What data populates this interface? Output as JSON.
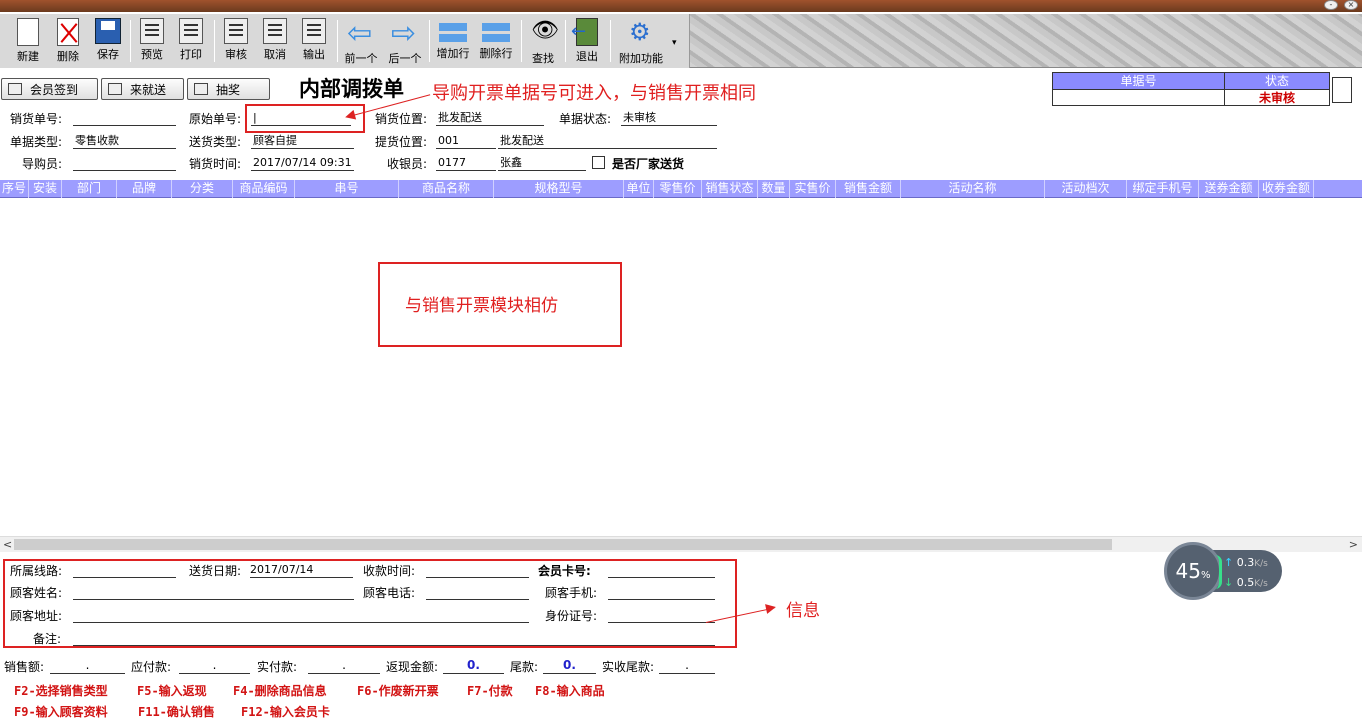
{
  "toolbar": {
    "buttons": [
      {
        "label": "新建",
        "icon": "new-document-icon"
      },
      {
        "label": "删除",
        "icon": "delete-icon"
      },
      {
        "label": "保存",
        "icon": "save-icon"
      },
      {
        "label": "预览",
        "icon": "preview-icon"
      },
      {
        "label": "打印",
        "icon": "print-icon"
      },
      {
        "label": "审核",
        "icon": "audit-icon"
      },
      {
        "label": "取消",
        "icon": "cancel-icon"
      },
      {
        "label": "输出",
        "icon": "export-icon"
      },
      {
        "label": "前一个",
        "icon": "previous-arrow-icon"
      },
      {
        "label": "后一个",
        "icon": "next-arrow-icon"
      },
      {
        "label": "增加行",
        "icon": "add-row-icon"
      },
      {
        "label": "删除行",
        "icon": "delete-row-icon"
      },
      {
        "label": "查找",
        "icon": "binoculars-icon"
      },
      {
        "label": "退出",
        "icon": "exit-door-icon"
      },
      {
        "label": "附加功能",
        "icon": "addon-gear-icon"
      }
    ]
  },
  "action_buttons": {
    "member_checkin": "会员签到",
    "nearby_delivery": "来就送",
    "lottery": "抽奖"
  },
  "form_title": "内部调拨单",
  "status_box": {
    "doc_no_header": "单据号",
    "status_header": "状态",
    "doc_no_value": "",
    "status_value": "未审核",
    "status_color": "#cc0000"
  },
  "header_fields": {
    "sales_doc_no": {
      "label": "销货单号:",
      "value": ""
    },
    "original_doc_no": {
      "label": "原始单号:",
      "value": "|"
    },
    "sales_location": {
      "label": "销货位置:",
      "value": "批发配送"
    },
    "doc_status": {
      "label": "单据状态:",
      "value": "未审核"
    },
    "doc_type": {
      "label": "单据类型:",
      "value": "零售收款"
    },
    "delivery_type": {
      "label": "送货类型:",
      "value": "顾客自提"
    },
    "pickup_location": {
      "label": "提货位置:",
      "code": "001",
      "value": "批发配送"
    },
    "salesperson": {
      "label": "导购员:",
      "value": ""
    },
    "sales_time": {
      "label": "销货时间:",
      "value": "2017/07/14 09:31"
    },
    "cashier": {
      "label": "收银员:",
      "code": "0177",
      "value": "张鑫"
    },
    "manufacturer_delivery": {
      "label": "是否厂家送货",
      "checked": false
    }
  },
  "grid": {
    "columns": [
      "序号",
      "安装",
      "部门",
      "品牌",
      "分类",
      "商品编码",
      "串号",
      "商品名称",
      "规格型号",
      "单位",
      "零售价",
      "销售状态",
      "数量",
      "实售价",
      "销售金额",
      "活动名称",
      "活动档次",
      "绑定手机号",
      "送券金额",
      "收券金额"
    ],
    "header_color": "#9d9dff"
  },
  "customer_info": {
    "route": {
      "label": "所属线路:",
      "value": ""
    },
    "delivery_date": {
      "label": "送货日期:",
      "value": "2017/07/14"
    },
    "payment_time": {
      "label": "收款时间:",
      "value": ""
    },
    "member_card": {
      "label": "会员卡号:",
      "value": ""
    },
    "customer_name": {
      "label": "顾客姓名:",
      "value": ""
    },
    "customer_phone": {
      "label": "顾客电话:",
      "value": ""
    },
    "customer_mobile": {
      "label": "顾客手机:",
      "value": ""
    },
    "customer_address": {
      "label": "顾客地址:",
      "value": ""
    },
    "id_number": {
      "label": "身份证号:",
      "value": ""
    },
    "remark": {
      "label": "备注:",
      "value": ""
    }
  },
  "totals": {
    "sales_amount": {
      "label": "销售额:",
      "value": "."
    },
    "payable": {
      "label": "应付款:",
      "value": "."
    },
    "paid": {
      "label": "实付款:",
      "value": "."
    },
    "cashback": {
      "label": "返现金额:",
      "value": "0."
    },
    "tail": {
      "label": "尾款:",
      "value": "0."
    },
    "actual_tail": {
      "label": "实收尾款:",
      "value": "."
    },
    "highlight_color": "#2222cc"
  },
  "function_keys": {
    "row1": [
      "F2-选择销售类型",
      "F5-输入返现",
      "F4-删除商品信息",
      "F6-作废新开票",
      "F7-付款",
      "F8-输入商品"
    ],
    "row2": [
      "F9-输入顾客资料",
      "F11-确认销售",
      "F12-输入会员卡"
    ]
  },
  "annotations": {
    "top_note": "导购开票单据号可进入，与销售开票相同",
    "center_note": "与销售开票模块相仿",
    "info_note": "信息"
  },
  "speed_widget": {
    "percent": "45",
    "percent_unit": "%",
    "upload": "0.3",
    "download": "0.5",
    "unit": "K/s"
  }
}
